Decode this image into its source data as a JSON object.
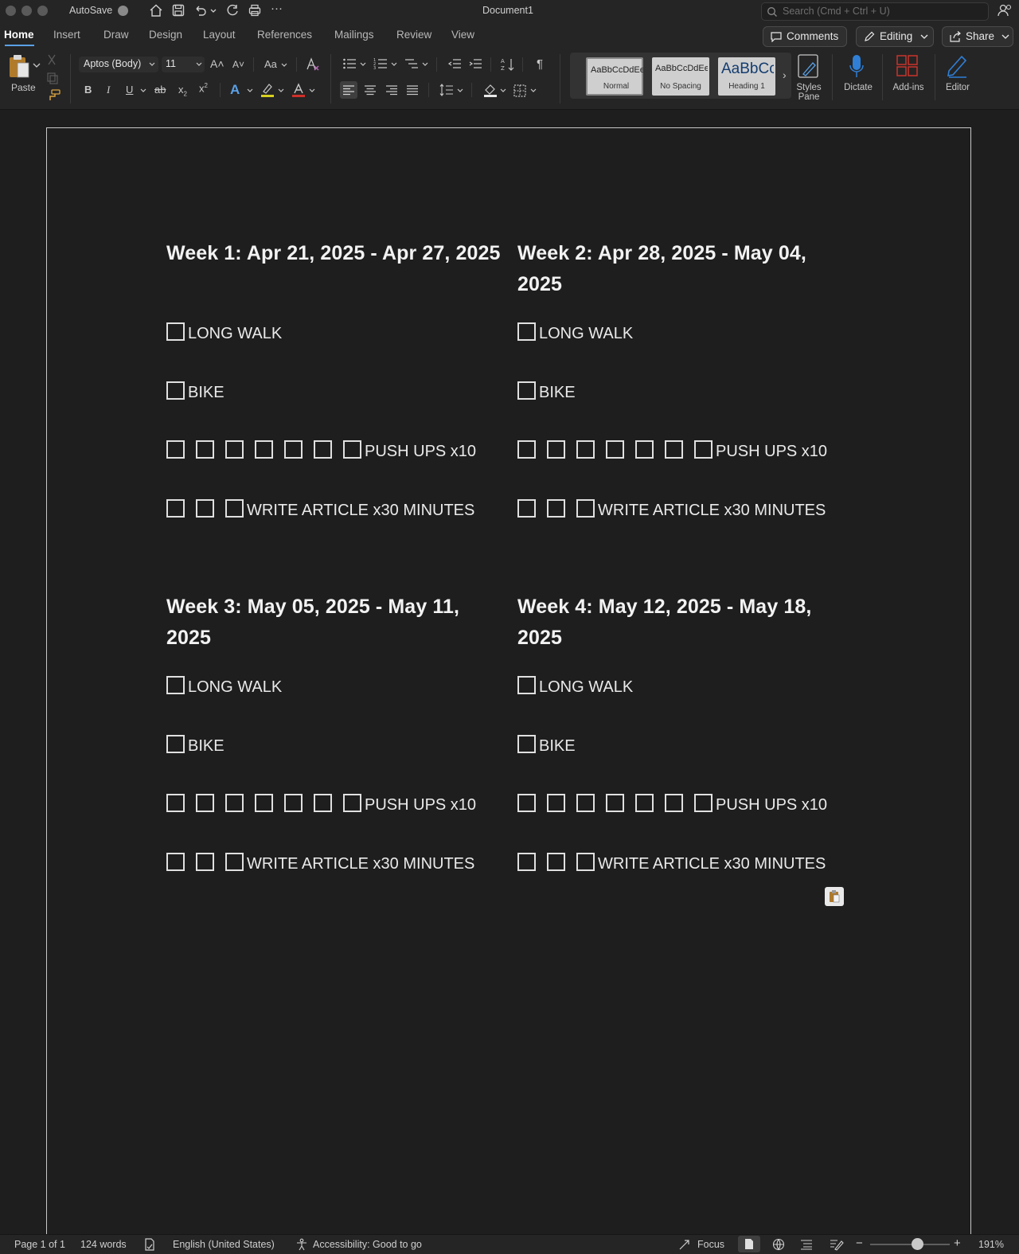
{
  "titlebar": {
    "autosave_label": "AutoSave",
    "document_title": "Document1",
    "search_placeholder": "Search (Cmd + Ctrl + U)"
  },
  "tabs": [
    "Home",
    "Insert",
    "Draw",
    "Design",
    "Layout",
    "References",
    "Mailings",
    "Review",
    "View"
  ],
  "active_tab": "Home",
  "header_buttons": {
    "comments": "Comments",
    "editing": "Editing",
    "share": "Share"
  },
  "ribbon": {
    "paste_label": "Paste",
    "font_name": "Aptos (Body)",
    "font_size": "11",
    "bold": "B",
    "italic": "I",
    "underline": "U",
    "change_case": "Aa",
    "styles": [
      {
        "preview": "AaBbCcDdEe",
        "name": "Normal"
      },
      {
        "preview": "AaBbCcDdEe",
        "name": "No Spacing"
      },
      {
        "preview": "AaBbCc",
        "name": "Heading 1"
      }
    ],
    "styles_pane_label": "Styles\nPane",
    "styles_pane_line1": "Styles",
    "styles_pane_line2": "Pane",
    "dictate_label": "Dictate",
    "addins_label": "Add-ins",
    "editor_label": "Editor"
  },
  "document": {
    "weeks": [
      {
        "title": "Week 1: Apr 21, 2025 - Apr 27, 2025",
        "tasks": [
          {
            "label": "LONG WALK",
            "boxes": 1
          },
          {
            "label": "BIKE",
            "boxes": 1
          },
          {
            "label": "PUSH UPS x10",
            "boxes": 7
          },
          {
            "label": "WRITE ARTICLE x30 MINUTES",
            "boxes": 3
          }
        ]
      },
      {
        "title": "Week 2: Apr 28, 2025 - May 04, 2025",
        "tasks": [
          {
            "label": "LONG WALK",
            "boxes": 1
          },
          {
            "label": "BIKE",
            "boxes": 1
          },
          {
            "label": "PUSH UPS x10",
            "boxes": 7
          },
          {
            "label": "WRITE ARTICLE x30 MINUTES",
            "boxes": 3
          }
        ]
      },
      {
        "title": "Week 3: May 05, 2025 - May 11, 2025",
        "tasks": [
          {
            "label": "LONG WALK",
            "boxes": 1
          },
          {
            "label": "BIKE",
            "boxes": 1
          },
          {
            "label": "PUSH UPS x10",
            "boxes": 7
          },
          {
            "label": "WRITE ARTICLE x30 MINUTES",
            "boxes": 3
          }
        ]
      },
      {
        "title": "Week 4: May 12, 2025 - May 18, 2025",
        "tasks": [
          {
            "label": "LONG WALK",
            "boxes": 1
          },
          {
            "label": "BIKE",
            "boxes": 1
          },
          {
            "label": "PUSH UPS x10",
            "boxes": 7
          },
          {
            "label": "WRITE ARTICLE x30 MINUTES",
            "boxes": 3
          }
        ]
      }
    ]
  },
  "statusbar": {
    "page": "Page 1 of 1",
    "words": "124 words",
    "language": "English (United States)",
    "accessibility": "Accessibility: Good to go",
    "focus": "Focus",
    "zoom": "191%"
  },
  "colors": {
    "accent": "#5aa0e6",
    "background": "#1e1e1e",
    "chrome": "#252525"
  }
}
